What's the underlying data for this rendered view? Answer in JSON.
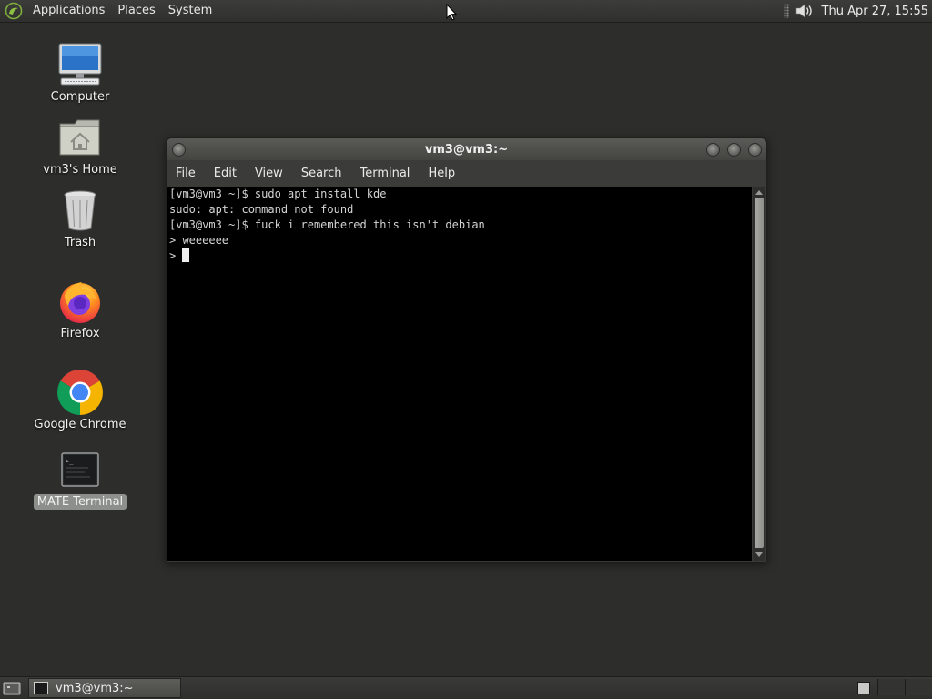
{
  "top_panel": {
    "menus": [
      "Applications",
      "Places",
      "System"
    ],
    "clock": "Thu Apr 27, 15:55",
    "icons": {
      "menu_logo": "mate-logo-icon",
      "volume": "volume-icon"
    }
  },
  "desktop_icons": [
    {
      "label": "Computer",
      "icon": "computer-icon"
    },
    {
      "label": "vm3's Home",
      "icon": "home-folder-icon"
    },
    {
      "label": "Trash",
      "icon": "trash-icon"
    },
    {
      "label": "Firefox",
      "icon": "firefox-icon"
    },
    {
      "label": "Google Chrome",
      "icon": "chrome-icon"
    },
    {
      "label": "MATE Terminal",
      "icon": "terminal-icon",
      "selected": true
    }
  ],
  "terminal_window": {
    "title": "vm3@vm3:~",
    "menu": [
      "File",
      "Edit",
      "View",
      "Search",
      "Terminal",
      "Help"
    ],
    "lines": [
      "[vm3@vm3 ~]$ sudo apt install kde",
      "sudo: apt: command not found",
      "[vm3@vm3 ~]$ fuck i remembered this isn't debian",
      "> weeeeee",
      "> "
    ]
  },
  "bottom_panel": {
    "task_label": "vm3@vm3:~",
    "icons": {
      "show_desktop": "show-desktop-icon",
      "task": "terminal-icon"
    }
  },
  "colors": {
    "desktop_bg": "#2d2e2b",
    "panel": "#3a3b38",
    "terminal_bg": "#000000",
    "terminal_fg": "#d4d4d4"
  }
}
